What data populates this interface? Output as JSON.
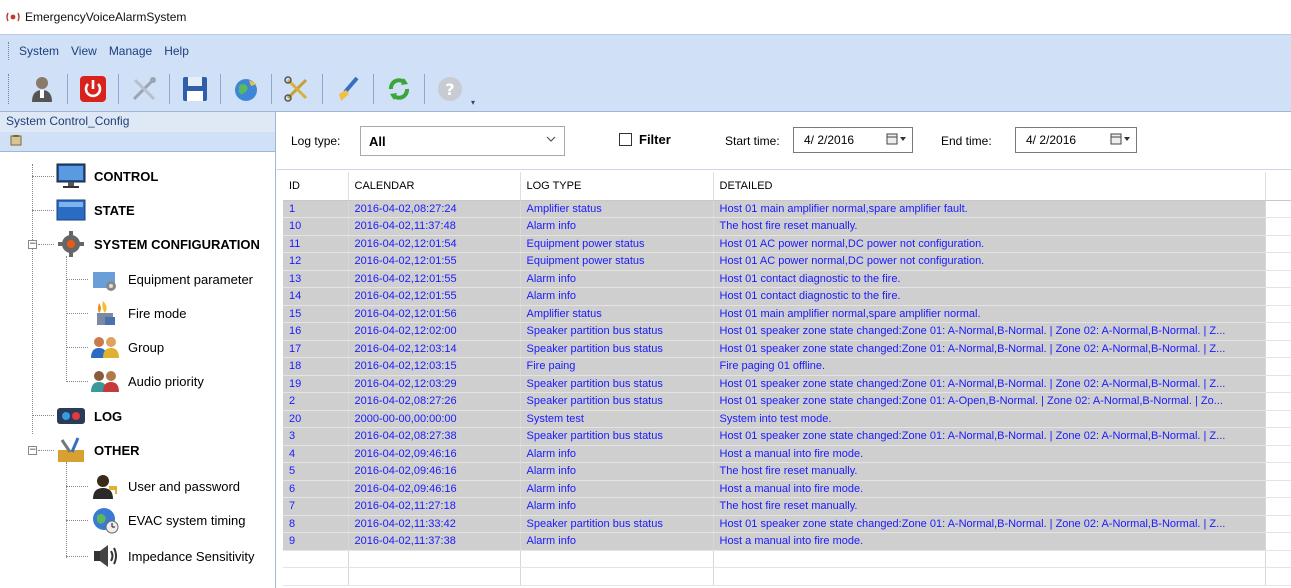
{
  "window": {
    "title": "EmergencyVoiceAlarmSystem"
  },
  "menu": [
    "System",
    "View",
    "Manage",
    "Help"
  ],
  "toolbar": {
    "icons": [
      "user-icon",
      "power-icon",
      "tools-icon",
      "save-icon",
      "globe-icon",
      "scissors-icon",
      "brush-icon",
      "refresh-icon",
      "help-icon"
    ]
  },
  "sidebar": {
    "title": "System Control_Config",
    "tree": [
      {
        "label": "CONTROL",
        "icon": "monitor-icon"
      },
      {
        "label": "STATE",
        "icon": "state-icon"
      },
      {
        "label": "SYSTEM CONFIGURATION",
        "icon": "gear-icon"
      },
      {
        "label": "Equipment parameter",
        "icon": "equipment-icon"
      },
      {
        "label": "Fire mode",
        "icon": "fire-icon"
      },
      {
        "label": "Group",
        "icon": "group-icon"
      },
      {
        "label": "Audio priority",
        "icon": "audio-priority-icon"
      },
      {
        "label": "LOG",
        "icon": "log-icon"
      },
      {
        "label": "OTHER",
        "icon": "other-icon"
      },
      {
        "label": "User and password",
        "icon": "user-password-icon"
      },
      {
        "label": "EVAC system timing",
        "icon": "timing-icon"
      },
      {
        "label": "Impedance Sensitivity",
        "icon": "speaker-icon"
      }
    ]
  },
  "filter": {
    "log_type_label": "Log type:",
    "log_type_value": "All",
    "filter_label": "Filter",
    "start_label": "Start time:",
    "start_value": "4/ 2/2016",
    "end_label": "End time:",
    "end_value": "4/ 2/2016"
  },
  "table": {
    "columns": [
      "ID",
      "CALENDAR",
      "LOG TYPE",
      "DETAILED"
    ],
    "rows": [
      [
        "1",
        "2016-04-02,08:27:24",
        "Amplifier status",
        "Host 01 main amplifier normal,spare amplifier fault."
      ],
      [
        "10",
        "2016-04-02,11:37:48",
        "Alarm info",
        "The host fire reset manually."
      ],
      [
        "11",
        "2016-04-02,12:01:54",
        "Equipment power status",
        "Host 01 AC power normal,DC power not configuration."
      ],
      [
        "12",
        "2016-04-02,12:01:55",
        "Equipment power status",
        "Host 01 AC power normal,DC power not configuration."
      ],
      [
        "13",
        "2016-04-02,12:01:55",
        "Alarm info",
        "Host 01 contact  diagnostic to the fire."
      ],
      [
        "14",
        "2016-04-02,12:01:55",
        "Alarm info",
        "Host 01 contact  diagnostic to the fire."
      ],
      [
        "15",
        "2016-04-02,12:01:56",
        "Amplifier status",
        "Host 01 main amplifier normal,spare amplifier normal."
      ],
      [
        "16",
        "2016-04-02,12:02:00",
        "Speaker partition bus status",
        "Host 01 speaker zone state changed:Zone 01: A-Normal,B-Normal. | Zone 02: A-Normal,B-Normal. | Z..."
      ],
      [
        "17",
        "2016-04-02,12:03:14",
        "Speaker partition bus status",
        "Host 01 speaker zone state changed:Zone 01: A-Normal,B-Normal. | Zone 02: A-Normal,B-Normal. | Z..."
      ],
      [
        "18",
        "2016-04-02,12:03:15",
        "Fire paing",
        "Fire paging 01 offline."
      ],
      [
        "19",
        "2016-04-02,12:03:29",
        "Speaker partition bus status",
        "Host 01 speaker zone state changed:Zone 01: A-Normal,B-Normal. | Zone 02: A-Normal,B-Normal. | Z..."
      ],
      [
        "2",
        "2016-04-02,08:27:26",
        "Speaker partition bus status",
        "Host 01 speaker zone state changed:Zone 01: A-Open,B-Normal. | Zone 02: A-Normal,B-Normal. | Zo..."
      ],
      [
        "20",
        "2000-00-00,00:00:00",
        "System test",
        "System into test mode."
      ],
      [
        "3",
        "2016-04-02,08:27:38",
        "Speaker partition bus status",
        "Host 01 speaker zone state changed:Zone 01: A-Normal,B-Normal. | Zone 02: A-Normal,B-Normal. | Z..."
      ],
      [
        "4",
        "2016-04-02,09:46:16",
        "Alarm info",
        "Host a manual into fire mode."
      ],
      [
        "5",
        "2016-04-02,09:46:16",
        "Alarm info",
        "The host fire reset manually."
      ],
      [
        "6",
        "2016-04-02,09:46:16",
        "Alarm info",
        "Host a manual into fire mode."
      ],
      [
        "7",
        "2016-04-02,11:27:18",
        "Alarm info",
        "The host fire reset manually."
      ],
      [
        "8",
        "2016-04-02,11:33:42",
        "Speaker partition bus status",
        "Host 01 speaker zone state changed:Zone 01: A-Normal,B-Normal. | Zone 02: A-Normal,B-Normal. | Z..."
      ],
      [
        "9",
        "2016-04-02,11:37:38",
        "Alarm info",
        "Host a manual into fire mode."
      ]
    ]
  },
  "colors": {
    "row_bg": "#cfcfcf",
    "row_text": "#1a1aff",
    "toolbar_bg": "#cfe0f7"
  }
}
